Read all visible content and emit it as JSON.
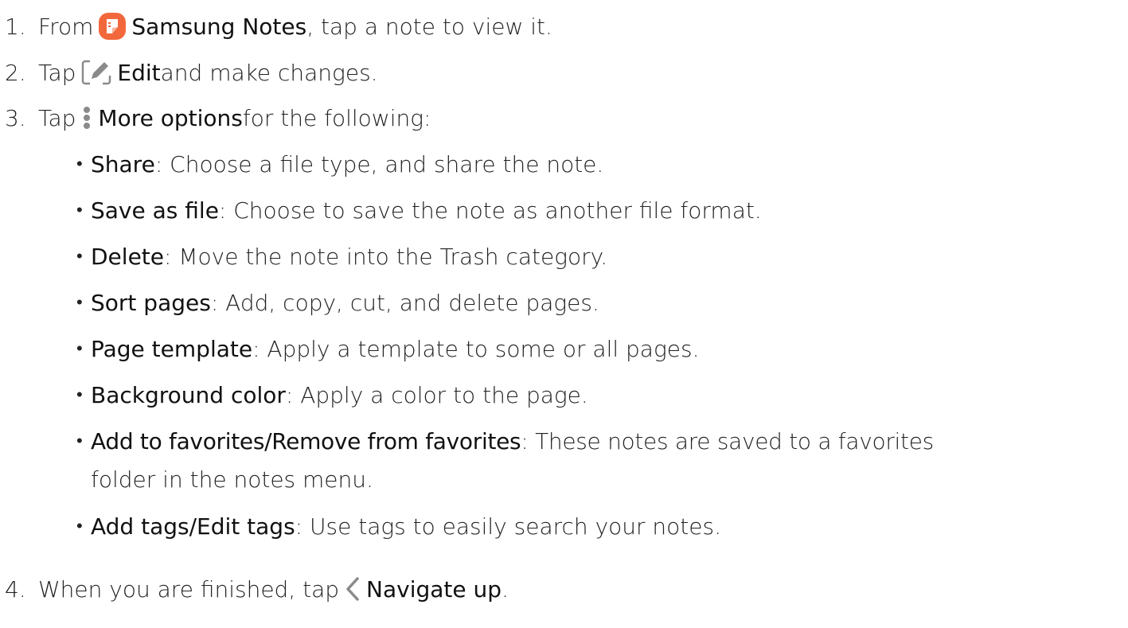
{
  "steps": [
    {
      "num": "1.",
      "pre": "From ",
      "term": "Samsung Notes",
      "post": ", tap a note to view it.",
      "icon": "samsung-notes-app-icon"
    },
    {
      "num": "2.",
      "pre": "Tap ",
      "term": "Edit",
      "post": " and make changes.",
      "icon": "edit-icon"
    },
    {
      "num": "3.",
      "pre": "Tap ",
      "term": "More options",
      "post": " for the following:",
      "icon": "more-options-icon"
    },
    {
      "num": "4.",
      "pre": "When you are finished, tap ",
      "term": "Navigate up",
      "post": ".",
      "icon": "navigate-up-icon"
    }
  ],
  "options": [
    {
      "term": "Share",
      "desc": ": Choose a file type, and share the note."
    },
    {
      "term": "Save as file",
      "desc": ": Choose to save the note as another file format."
    },
    {
      "term": "Delete",
      "desc": ": Move the note into the Trash category."
    },
    {
      "term": "Sort pages",
      "desc": ": Add, copy, cut, and delete pages."
    },
    {
      "term": "Page template",
      "desc": ": Apply a template to some or all pages."
    },
    {
      "term": "Background color",
      "desc": ": Apply a color to the page."
    },
    {
      "term": "Add to favorites/Remove from favorites",
      "desc": ": These notes are saved to a favorites",
      "cont": "folder in the notes menu."
    },
    {
      "term": "Add tags/Edit tags",
      "desc": ": Use tags to easily search your notes."
    }
  ],
  "bullet": "•",
  "colors": {
    "notes_icon": "#F2683C",
    "icon_gray": "#8a8a8a"
  }
}
